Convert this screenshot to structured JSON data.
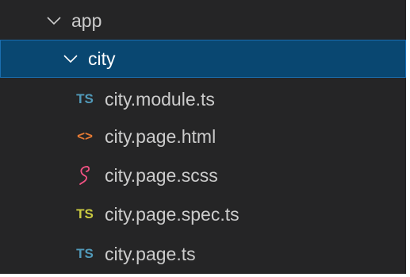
{
  "tree": {
    "folders": [
      {
        "label": "app",
        "expanded": true
      },
      {
        "label": "city",
        "expanded": true,
        "selected": true
      }
    ],
    "files": [
      {
        "label": "city.module.ts",
        "icon": "typescript-icon",
        "icon_text": "TS",
        "icon_color": "#519aba"
      },
      {
        "label": "city.page.html",
        "icon": "html-icon",
        "icon_text": "<>",
        "icon_color": "#e37933"
      },
      {
        "label": "city.page.scss",
        "icon": "sass-icon",
        "icon_text": "",
        "icon_color": "#f55385"
      },
      {
        "label": "city.page.spec.ts",
        "icon": "typescript-spec-icon",
        "icon_text": "TS",
        "icon_color": "#cbcb41"
      },
      {
        "label": "city.page.ts",
        "icon": "typescript-icon",
        "icon_text": "TS",
        "icon_color": "#519aba"
      }
    ]
  },
  "colors": {
    "background": "#252526",
    "selected_background": "#094771",
    "selected_border": "#1a6eb0",
    "text": "#cccccc"
  }
}
